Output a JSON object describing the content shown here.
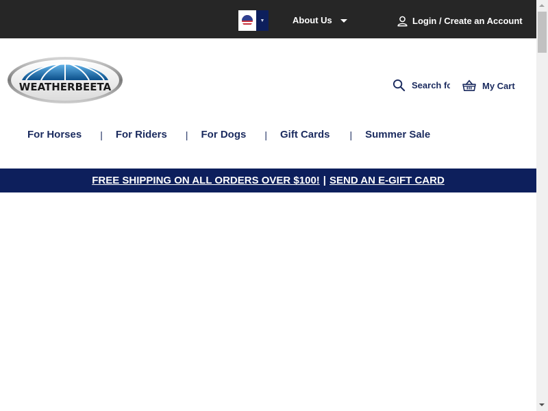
{
  "topbar": {
    "country": {
      "flag_icon": "us-flag-icon",
      "selected": "US"
    },
    "about_label": "About Us",
    "login_label": "Login / Create an Account"
  },
  "header": {
    "logo_text": "WEATHERBEETA",
    "search_placeholder": "Search for",
    "cart_label": "My Cart"
  },
  "nav": {
    "items": [
      {
        "label": "For Horses"
      },
      {
        "label": "For Riders"
      },
      {
        "label": "For Dogs"
      },
      {
        "label": "Gift Cards"
      },
      {
        "label": "Summer Sale"
      }
    ],
    "separator": "|"
  },
  "promo": {
    "shipping_link": "FREE SHIPPING ON ALL ORDERS OVER $100!",
    "separator": "|",
    "gift_link": "SEND AN E-GIFT CARD"
  },
  "colors": {
    "topbar_bg": "#262626",
    "brand_navy": "#0d1f5c",
    "nav_text": "#1a2a5e"
  }
}
